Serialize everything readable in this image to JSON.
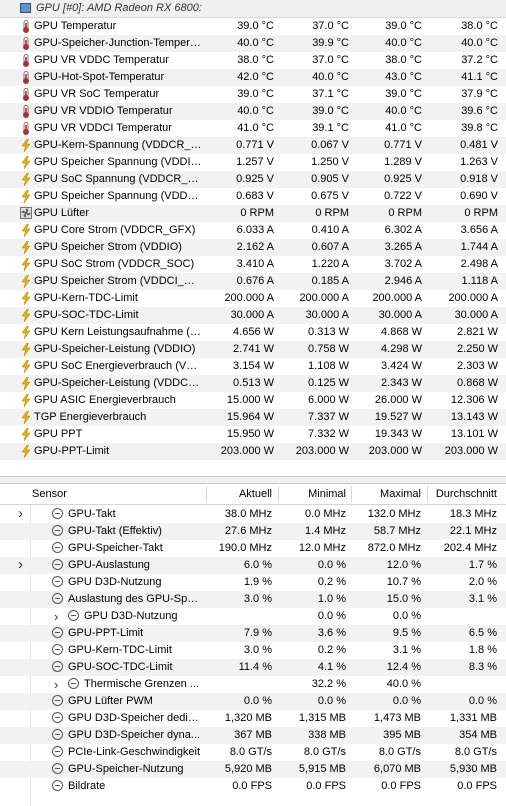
{
  "top": {
    "group_title": "GPU [#0]: AMD Radeon RX 6800:",
    "rows": [
      {
        "icon": "thermometer-icon",
        "label": "GPU Temperatur",
        "v": [
          "39.0 °C",
          "37.0 °C",
          "39.0 °C",
          "38.0 °C"
        ]
      },
      {
        "icon": "thermometer-icon",
        "label": "GPU-Speicher-Junction-Tempera...",
        "v": [
          "40.0 °C",
          "39.9 °C",
          "40.0 °C",
          "40.0 °C"
        ]
      },
      {
        "icon": "thermometer-icon",
        "label": "GPU VR VDDC Temperatur",
        "v": [
          "38.0 °C",
          "37.0 °C",
          "38.0 °C",
          "37.2 °C"
        ]
      },
      {
        "icon": "thermometer-icon",
        "label": "GPU-Hot-Spot-Temperatur",
        "v": [
          "42.0 °C",
          "40.0 °C",
          "43.0 °C",
          "41.1 °C"
        ]
      },
      {
        "icon": "thermometer-icon",
        "label": "GPU VR SoC Temperatur",
        "v": [
          "39.0 °C",
          "37.1 °C",
          "39.0 °C",
          "37.9 °C"
        ]
      },
      {
        "icon": "thermometer-icon",
        "label": "GPU VR VDDIO Temperatur",
        "v": [
          "40.0 °C",
          "39.0 °C",
          "40.0 °C",
          "39.6 °C"
        ]
      },
      {
        "icon": "thermometer-icon",
        "label": "GPU VR VDDCI Temperatur",
        "v": [
          "41.0 °C",
          "39.1 °C",
          "41.0 °C",
          "39.8 °C"
        ]
      },
      {
        "icon": "lightning-icon",
        "label": "GPU-Kern-Spannung (VDDCR_G...",
        "v": [
          "0.771 V",
          "0.067 V",
          "0.771 V",
          "0.481 V"
        ]
      },
      {
        "icon": "lightning-icon",
        "label": "GPU Speicher Spannung (VDDIO)",
        "v": [
          "1.257 V",
          "1.250 V",
          "1.289 V",
          "1.263 V"
        ]
      },
      {
        "icon": "lightning-icon",
        "label": "GPU SoC Spannung (VDDCR_SOC)",
        "v": [
          "0.925 V",
          "0.905 V",
          "0.925 V",
          "0.918 V"
        ]
      },
      {
        "icon": "lightning-icon",
        "label": "GPU Speicher Spannung (VDDCI...",
        "v": [
          "0.683 V",
          "0.675 V",
          "0.722 V",
          "0.690 V"
        ]
      },
      {
        "icon": "fan-icon",
        "label": "GPU Lüfter",
        "v": [
          "0 RPM",
          "0 RPM",
          "0 RPM",
          "0 RPM"
        ]
      },
      {
        "icon": "lightning-icon",
        "label": "GPU Core Strom (VDDCR_GFX)",
        "v": [
          "6.033 A",
          "0.410 A",
          "6.302 A",
          "3.656 A"
        ]
      },
      {
        "icon": "lightning-icon",
        "label": "GPU Speicher Strom (VDDIO)",
        "v": [
          "2.162 A",
          "0.607 A",
          "3.265 A",
          "1.744 A"
        ]
      },
      {
        "icon": "lightning-icon",
        "label": "GPU SoC Strom (VDDCR_SOC)",
        "v": [
          "3.410 A",
          "1.220 A",
          "3.702 A",
          "2.498 A"
        ]
      },
      {
        "icon": "lightning-icon",
        "label": "GPU Speicher Strom (VDDCI_MEM)",
        "v": [
          "0.676 A",
          "0.185 A",
          "2.946 A",
          "1.118 A"
        ]
      },
      {
        "icon": "lightning-icon",
        "label": "GPU-Kern-TDC-Limit",
        "v": [
          "200.000 A",
          "200.000 A",
          "200.000 A",
          "200.000 A"
        ]
      },
      {
        "icon": "lightning-icon",
        "label": "GPU-SOC-TDC-Limit",
        "v": [
          "30.000 A",
          "30.000 A",
          "30.000 A",
          "30.000 A"
        ]
      },
      {
        "icon": "lightning-icon",
        "label": "GPU Kern Leistungsaufnahme (V...",
        "v": [
          "4.656 W",
          "0.313 W",
          "4.868 W",
          "2.821 W"
        ]
      },
      {
        "icon": "lightning-icon",
        "label": "GPU-Speicher-Leistung (VDDIO)",
        "v": [
          "2.741 W",
          "0.758 W",
          "4.298 W",
          "2.250 W"
        ]
      },
      {
        "icon": "lightning-icon",
        "label": "GPU SoC Energieverbrauch (VD...",
        "v": [
          "3.154 W",
          "1.108 W",
          "3.424 W",
          "2.303 W"
        ]
      },
      {
        "icon": "lightning-icon",
        "label": "GPU-Speicher-Leistung (VDDCI_...",
        "v": [
          "0.513 W",
          "0.125 W",
          "2.343 W",
          "0.868 W"
        ]
      },
      {
        "icon": "lightning-icon",
        "label": "GPU ASIC Energieverbrauch",
        "v": [
          "15.000 W",
          "6.000 W",
          "26.000 W",
          "12.306 W"
        ]
      },
      {
        "icon": "lightning-icon",
        "label": "TGP Energieverbrauch",
        "v": [
          "15.964 W",
          "7.337 W",
          "19.527 W",
          "13.143 W"
        ]
      },
      {
        "icon": "lightning-icon",
        "label": "GPU PPT",
        "v": [
          "15.950 W",
          "7.332 W",
          "19.343 W",
          "13.101 W"
        ]
      },
      {
        "icon": "lightning-icon",
        "label": "GPU-PPT-Limit",
        "v": [
          "203.000 W",
          "203.000 W",
          "203.000 W",
          "203.000 W"
        ]
      }
    ]
  },
  "bottom": {
    "headers": {
      "sensor": "Sensor",
      "current": "Aktuell",
      "min": "Minimal",
      "max": "Maximal",
      "avg": "Durchschnitt"
    },
    "rows": [
      {
        "label": "GPU-Takt",
        "v": [
          "38.0 MHz",
          "0.0 MHz",
          "132.0 MHz",
          "18.3 MHz"
        ],
        "indent": 0,
        "expander": false,
        "gutter_arrow": true
      },
      {
        "label": "GPU-Takt (Effektiv)",
        "v": [
          "27.6 MHz",
          "1.4 MHz",
          "58.7 MHz",
          "22.1 MHz"
        ],
        "indent": 0,
        "expander": false,
        "gutter_arrow": false
      },
      {
        "label": "GPU-Speicher-Takt",
        "v": [
          "190.0 MHz",
          "12.0 MHz",
          "872.0 MHz",
          "202.4 MHz"
        ],
        "indent": 0,
        "expander": false,
        "gutter_arrow": false
      },
      {
        "label": "GPU-Auslastung",
        "v": [
          "6.0 %",
          "0.0 %",
          "12.0 %",
          "1.7 %"
        ],
        "indent": 0,
        "expander": false,
        "gutter_arrow": true
      },
      {
        "label": "GPU D3D-Nutzung",
        "v": [
          "1.9 %",
          "0.2 %",
          "10.7 %",
          "2.0 %"
        ],
        "indent": 0,
        "expander": false,
        "gutter_arrow": false
      },
      {
        "label": "Auslastung des GPU-Spei...",
        "v": [
          "3.0 %",
          "1.0 %",
          "15.0 %",
          "3.1 %"
        ],
        "indent": 0,
        "expander": false,
        "gutter_arrow": false
      },
      {
        "label": "GPU D3D-Nutzung",
        "v": [
          "",
          "0.0 %",
          "0.0 %",
          ""
        ],
        "indent": 1,
        "expander": true,
        "gutter_arrow": false
      },
      {
        "label": "GPU-PPT-Limit",
        "v": [
          "7.9 %",
          "3.6 %",
          "9.5 %",
          "6.5 %"
        ],
        "indent": 0,
        "expander": false,
        "gutter_arrow": false
      },
      {
        "label": "GPU-Kern-TDC-Limit",
        "v": [
          "3.0 %",
          "0.2 %",
          "3.1 %",
          "1.8 %"
        ],
        "indent": 0,
        "expander": false,
        "gutter_arrow": false
      },
      {
        "label": "GPU-SOC-TDC-Limit",
        "v": [
          "11.4 %",
          "4.1 %",
          "12.4 %",
          "8.3 %"
        ],
        "indent": 0,
        "expander": false,
        "gutter_arrow": false
      },
      {
        "label": "Thermische Grenzen ...",
        "v": [
          "",
          "32.2 %",
          "40.0 %",
          ""
        ],
        "indent": 1,
        "expander": true,
        "gutter_arrow": false
      },
      {
        "label": "GPU Lüfter PWM",
        "v": [
          "0.0 %",
          "0.0 %",
          "0.0 %",
          "0.0 %"
        ],
        "indent": 0,
        "expander": false,
        "gutter_arrow": false
      },
      {
        "label": "GPU D3D-Speicher dediziert",
        "v": [
          "1,320 MB",
          "1,315 MB",
          "1,473 MB",
          "1,331 MB"
        ],
        "indent": 0,
        "expander": false,
        "gutter_arrow": false
      },
      {
        "label": "GPU D3D-Speicher dyna...",
        "v": [
          "367 MB",
          "338 MB",
          "395 MB",
          "354 MB"
        ],
        "indent": 0,
        "expander": false,
        "gutter_arrow": false
      },
      {
        "label": "PCIe-Link-Geschwindigkeit",
        "v": [
          "8.0 GT/s",
          "8.0 GT/s",
          "8.0 GT/s",
          "8.0 GT/s"
        ],
        "indent": 0,
        "expander": false,
        "gutter_arrow": false
      },
      {
        "label": "GPU-Speicher-Nutzung",
        "v": [
          "5,920 MB",
          "5,915 MB",
          "6,070 MB",
          "5,930 MB"
        ],
        "indent": 0,
        "expander": false,
        "gutter_arrow": false
      },
      {
        "label": "Bildrate",
        "v": [
          "0.0 FPS",
          "0.0 FPS",
          "0.0 FPS",
          "0.0 FPS"
        ],
        "indent": 0,
        "expander": false,
        "gutter_arrow": false
      }
    ]
  },
  "colors": {
    "lightning": "#e8b400",
    "thermo_red": "#d02020",
    "thermo_blue": "#3a5fb0",
    "row_alt": "#f2f2f2"
  }
}
